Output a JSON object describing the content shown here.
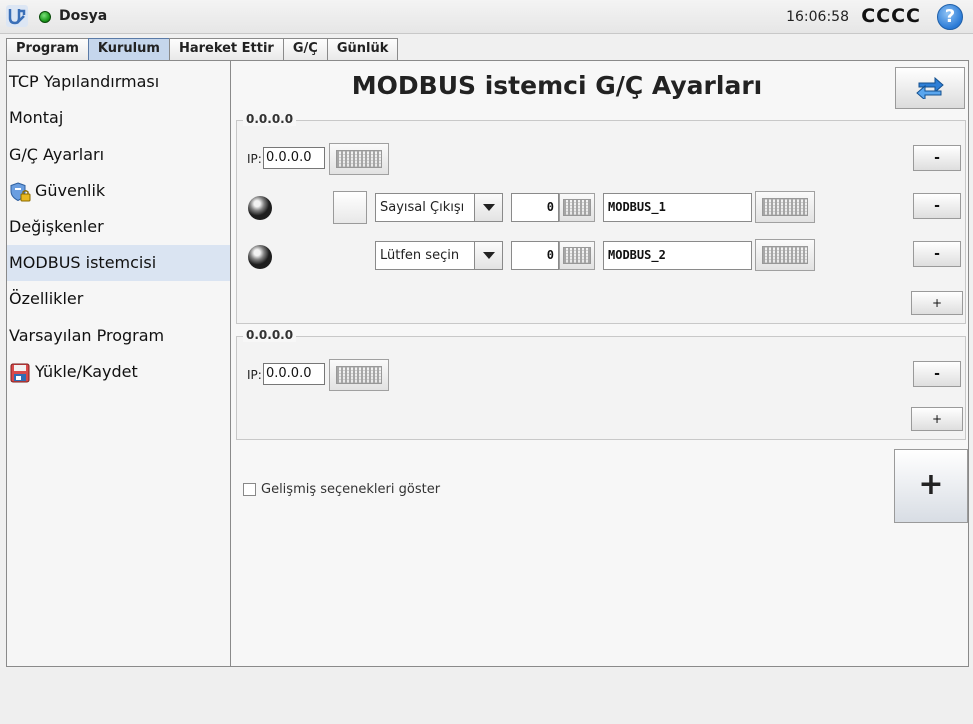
{
  "header": {
    "title": "Dosya",
    "time": "16:06:58",
    "robot_name": "CCCC",
    "help": "?",
    "icons": {
      "logo": "ur-logo-icon",
      "status": "status-dot-icon",
      "help": "help-icon"
    },
    "colors": {
      "status": "#1e9c1e",
      "help": "#2a7ad6",
      "active_tab": "#c5d6ec"
    }
  },
  "tabs": [
    {
      "label": "Program",
      "active": false
    },
    {
      "label": "Kurulum",
      "active": true
    },
    {
      "label": "Hareket Ettir",
      "active": false
    },
    {
      "label": "G/Ç",
      "active": false
    },
    {
      "label": "Günlük",
      "active": false
    }
  ],
  "sidebar": {
    "items": [
      {
        "label": "TCP Yapılandırması",
        "active": false
      },
      {
        "label": "Montaj",
        "active": false
      },
      {
        "label": "G/Ç Ayarları",
        "active": false
      },
      {
        "label": "Güvenlik",
        "active": false,
        "icon": "shield-lock-icon"
      },
      {
        "label": "Değişkenler",
        "active": false
      },
      {
        "label": "MODBUS istemcisi",
        "active": true
      },
      {
        "label": "Özellikler",
        "active": false
      },
      {
        "label": "Varsayılan Program",
        "active": false
      },
      {
        "label": "Yükle/Kaydet",
        "active": false,
        "icon": "floppy-disk-icon"
      }
    ]
  },
  "main": {
    "title": "MODBUS istemci G/Ç Ayarları",
    "refresh_icon": "refresh-arrows-icon",
    "servers": [
      {
        "label": "0.0.0.0",
        "ip_label": "IP:",
        "ip_value": "0.0.0.0",
        "remove_label": "-",
        "add_label": "+",
        "signals": [
          {
            "type": "Sayısal Çıkışı",
            "address": "0",
            "name": "MODBUS_1",
            "remove_label": "-"
          },
          {
            "type": "Lütfen seçin",
            "address": "0",
            "name": "MODBUS_2",
            "remove_label": "-"
          }
        ]
      },
      {
        "label": "0.0.0.0",
        "ip_label": "IP:",
        "ip_value": "0.0.0.0",
        "remove_label": "-",
        "add_label": "+",
        "signals": []
      }
    ],
    "advanced_label": "Gelişmiş seçenekleri göster",
    "advanced_checked": false,
    "add_server_label": "+"
  }
}
